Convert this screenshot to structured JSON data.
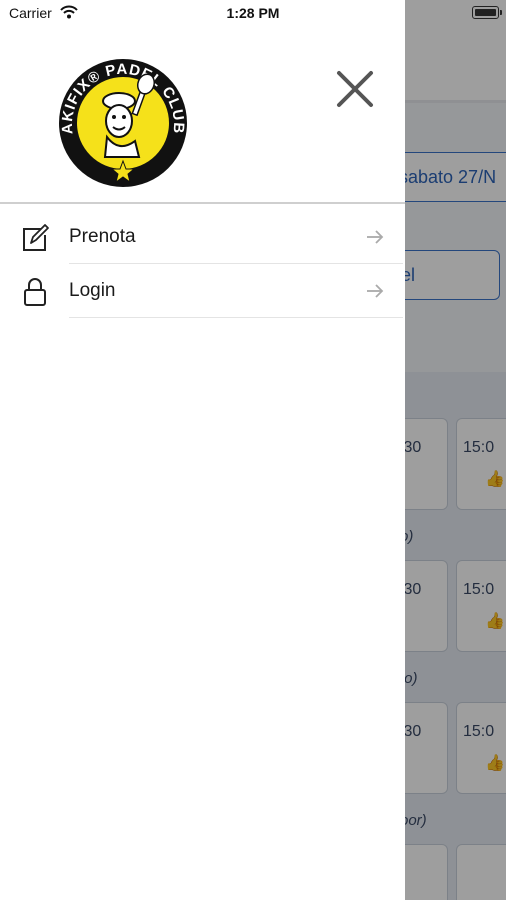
{
  "status_bar": {
    "carrier": "Carrier",
    "time": "1:28 PM",
    "wifi_icon": "wifi-icon",
    "battery_icon": "battery-icon"
  },
  "drawer": {
    "logo_icon": "akifix-padel-club-logo",
    "logo_text": "AKIFIX® PADEL CLUB",
    "close_icon": "close-icon",
    "menu": [
      {
        "label": "Prenota",
        "icon": "edit-icon",
        "arrow": "arrow-right-icon"
      },
      {
        "label": "Login",
        "icon": "lock-icon",
        "arrow": "arrow-right-icon"
      }
    ]
  },
  "background": {
    "date_button": "sabato 27/N",
    "select_button": "el",
    "sections": [
      "o)",
      "to)",
      "oor)"
    ],
    "slot_times": [
      ":30",
      "15:0",
      ":30",
      "15:0",
      ":30",
      "15:0"
    ]
  },
  "colors": {
    "logo_yellow": "#f5e11a",
    "accent_blue": "#2c63b8",
    "thumb_green": "#2eaa4a",
    "scrim": "rgba(0,0,0,0.38)"
  }
}
